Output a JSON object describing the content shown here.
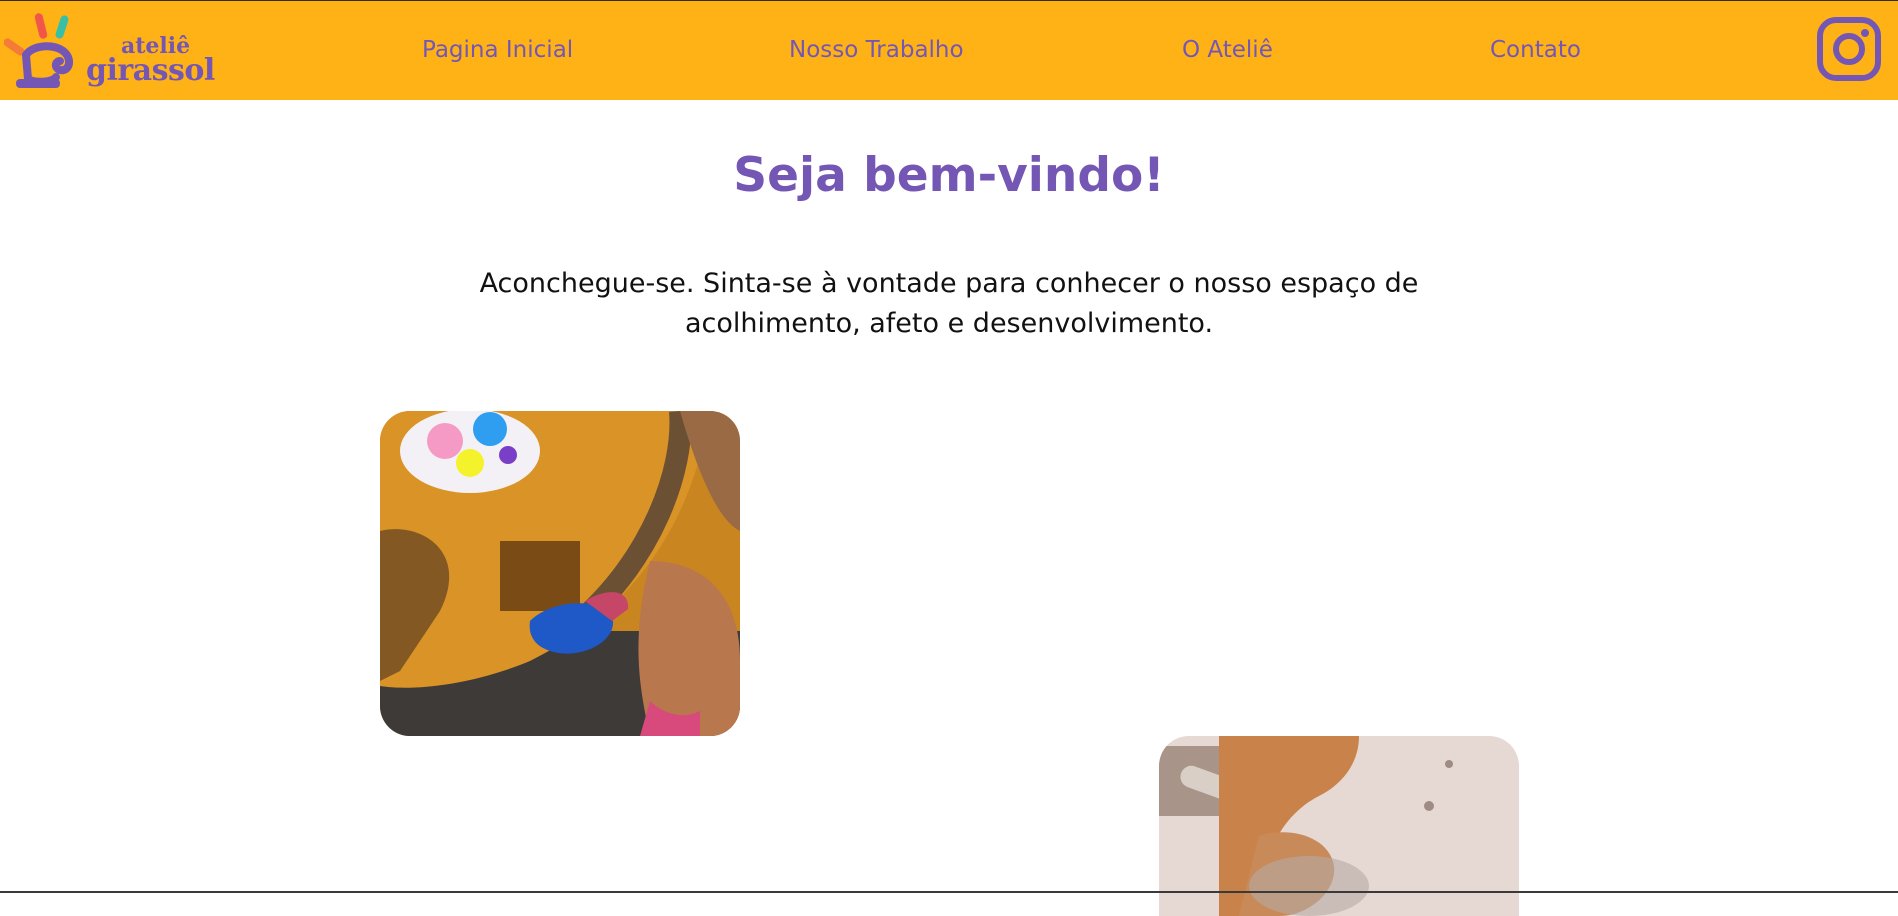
{
  "brand": {
    "line1": "ateliê",
    "line2": "girassol",
    "colors": {
      "nav_bg": "#FFB215",
      "purple": "#7457B4",
      "ray_red": "#F2564A",
      "ray_teal": "#38BFA7",
      "ray_orange": "#F47C36"
    }
  },
  "nav": {
    "items": [
      {
        "label": "Pagina Inicial"
      },
      {
        "label": "Nosso Trabalho"
      },
      {
        "label": "O Ateliê"
      },
      {
        "label": "Contato"
      }
    ],
    "social_icon": "instagram-icon"
  },
  "main": {
    "heading": "Seja bem-vindo!",
    "intro": "Aconchegue-se. Sinta-se à vontade para conhecer o nosso espaço de acolhimento, afeto e desenvolvimento."
  },
  "colors": {
    "text_dark": "#111111",
    "background": "#FFFFFF"
  }
}
